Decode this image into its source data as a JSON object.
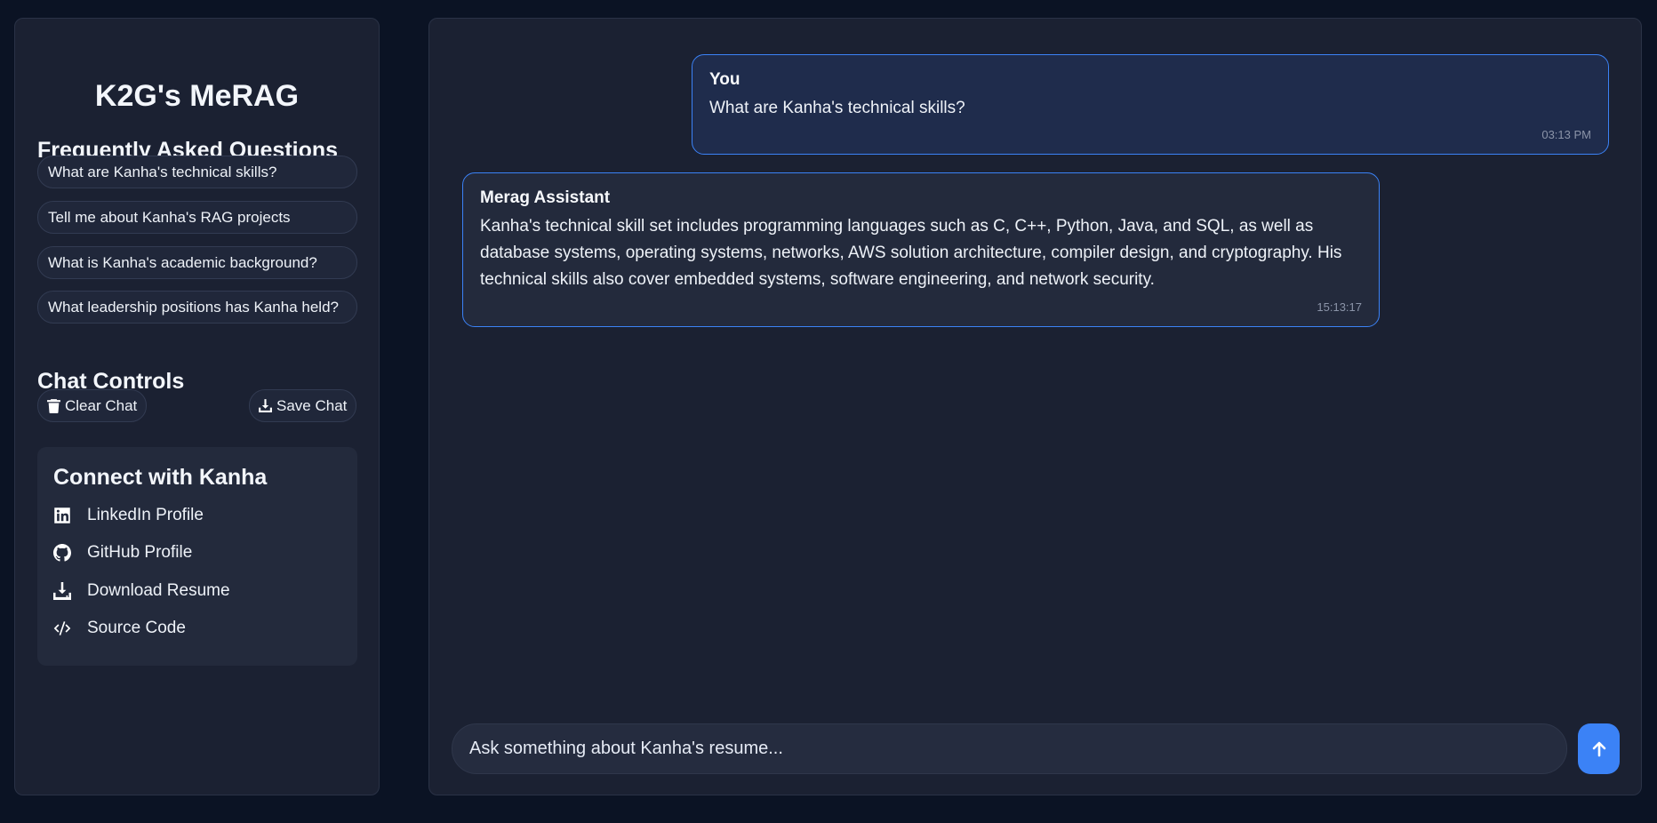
{
  "sidebar": {
    "app_title": "K2G's MeRAG",
    "faq_title": "Frequently Asked Questions",
    "faq": [
      "What are Kanha's technical skills?",
      "Tell me about Kanha's RAG projects",
      "What is Kanha's academic background?",
      "What leadership positions has Kanha held?"
    ],
    "controls_title": "Chat Controls",
    "clear_label": "Clear Chat",
    "save_label": "Save Chat",
    "connect": {
      "title": "Connect with Kanha",
      "links": [
        {
          "label": "LinkedIn Profile",
          "icon": "linkedin-icon"
        },
        {
          "label": "GitHub Profile",
          "icon": "github-icon"
        },
        {
          "label": "Download Resume",
          "icon": "download-icon"
        },
        {
          "label": "Source Code",
          "icon": "code-icon"
        }
      ]
    }
  },
  "chat": {
    "messages": [
      {
        "sender": "You",
        "text": "What are Kanha's technical skills?",
        "time": "03:13 PM"
      },
      {
        "sender": "Merag Assistant",
        "text": "Kanha's technical skill set includes programming languages such as C, C++, Python, Java, and SQL, as well as database systems, operating systems, networks, AWS solution architecture, compiler design, and cryptography. His technical skills also cover embedded systems, software engineering, and network security.",
        "time": "15:13:17"
      }
    ],
    "input_placeholder": "Ask something about Kanha's resume..."
  },
  "colors": {
    "accent": "#3b82f6",
    "background": "#0b1324",
    "panel": "#1b2132"
  }
}
